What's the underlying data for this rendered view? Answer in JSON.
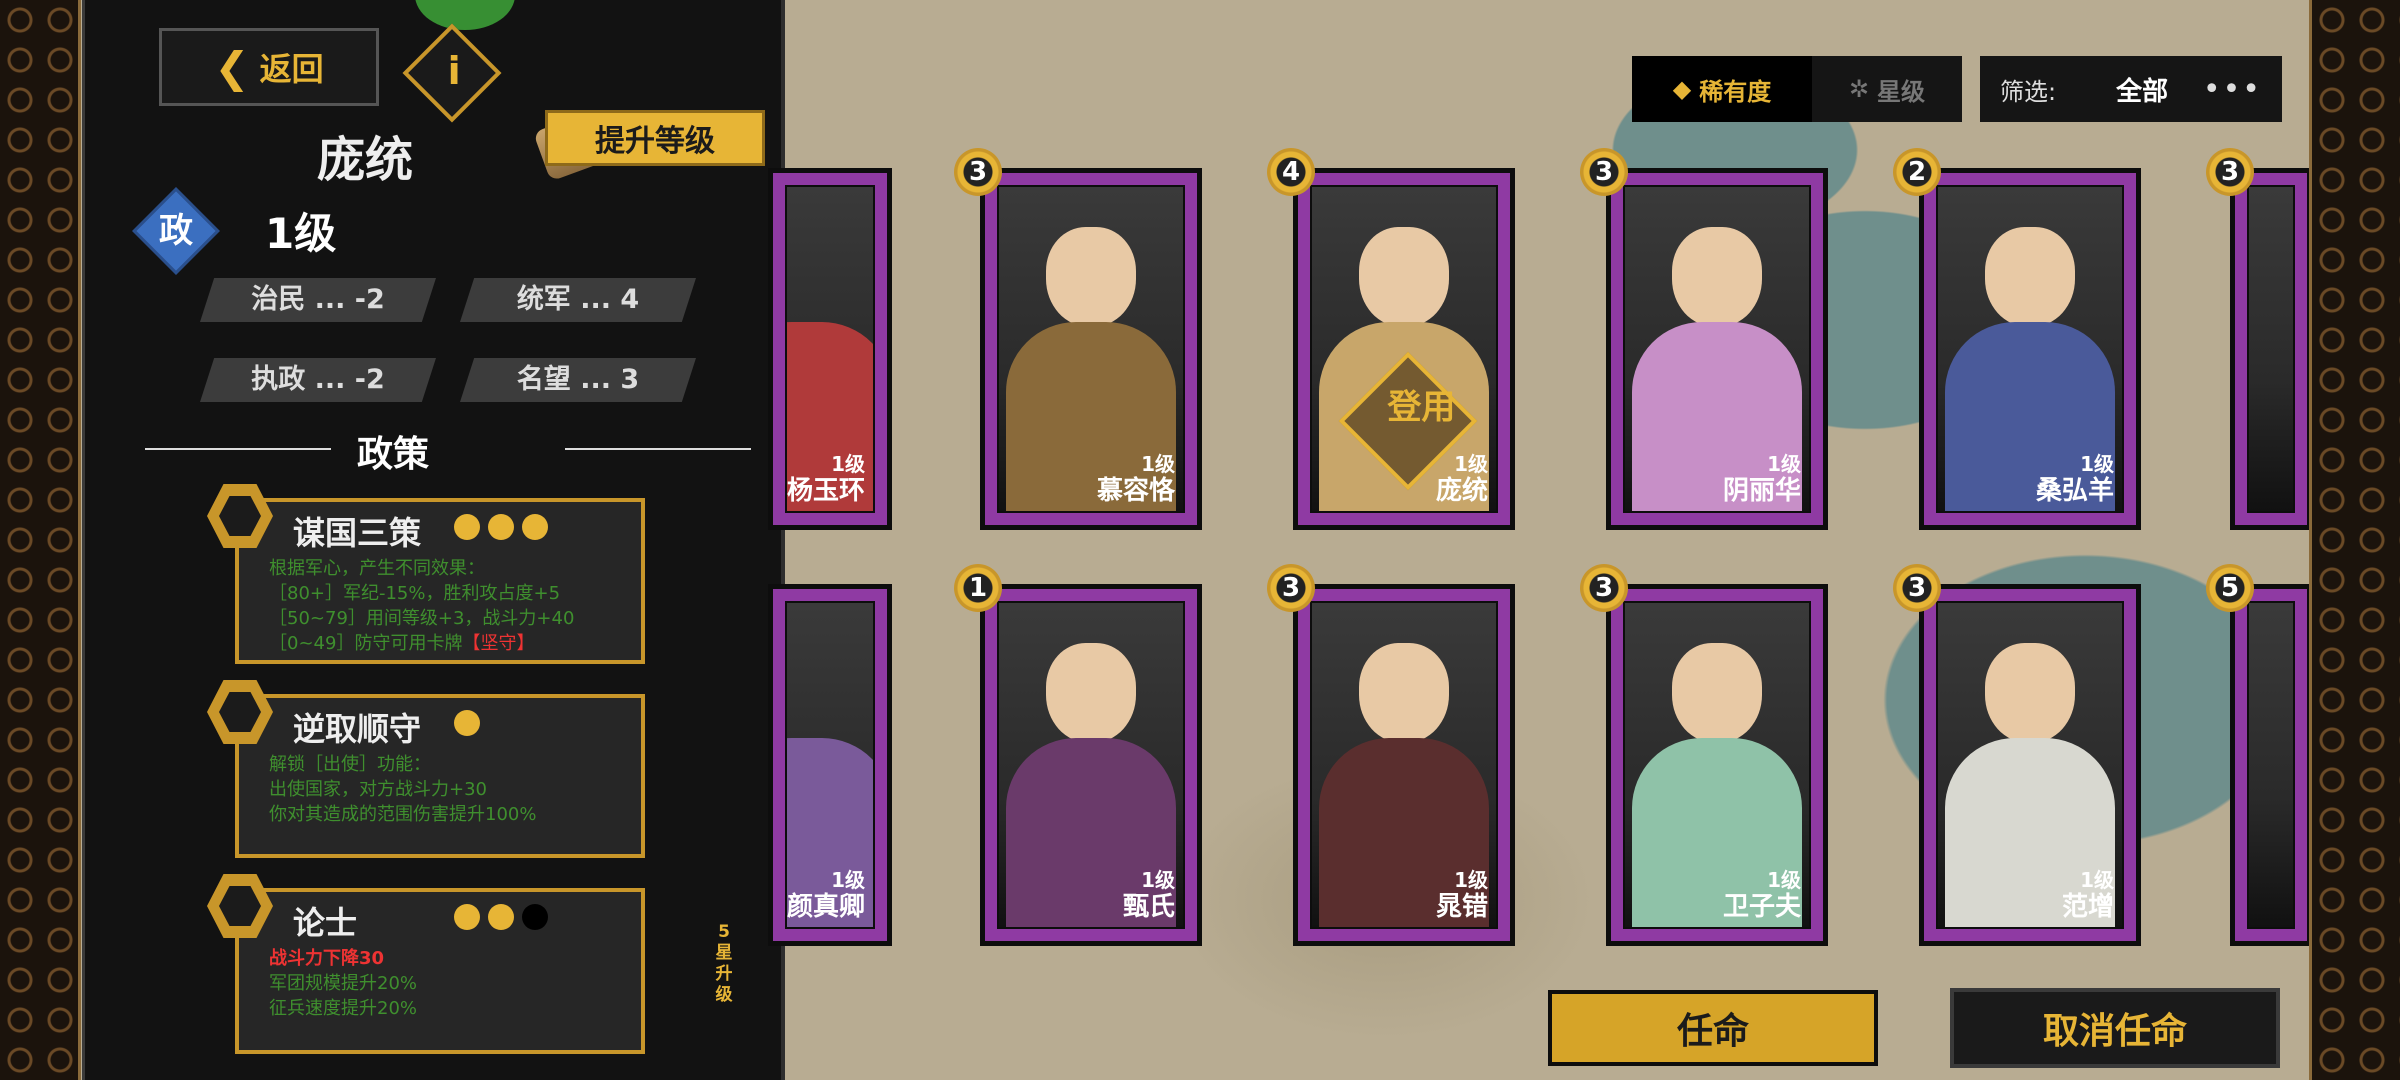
{
  "panel": {
    "back_label": "返回",
    "info_label": "i",
    "upgrade_label": "提升等级",
    "character_name": "庞统",
    "role_label": "政",
    "role_level": "1级",
    "stats": [
      {
        "label": "治民 ... -2"
      },
      {
        "label": "统军 ... 4"
      },
      {
        "label": "执政 ... -2"
      },
      {
        "label": "名望 ... 3"
      }
    ],
    "section_title": "政策",
    "policies": [
      {
        "title": "谋国三策",
        "dots_on": 3,
        "dots_total": 3,
        "lines": [
          "根据军心，产生不同效果：",
          "［80+］军纪-15%，胜利攻占度+5",
          "［50~79］用间等级+3，战斗力+40",
          "［0~49］防守可用卡牌"
        ],
        "tag": "【坚守】"
      },
      {
        "title": "逆取顺守",
        "dots_on": 1,
        "dots_total": 1,
        "lines": [
          "解锁［出使］功能：",
          "出使国家，对方战斗力+30",
          "你对其造成的范围伤害提升100%"
        ]
      },
      {
        "title": "论士",
        "dots_on": 2,
        "dots_total": 3,
        "red_line": "战斗力下降30",
        "lines": [
          "军团规模提升20%",
          "征兵速度提升20%"
        ],
        "star_note": "5星升级"
      }
    ]
  },
  "sort": {
    "active_label": "稀有度",
    "inactive_label": "星级"
  },
  "filter": {
    "label": "筛选:",
    "value": "全部",
    "more": "•••"
  },
  "cards_row1": [
    {
      "name": "杨玉环",
      "level": "1级",
      "rarity": ""
    },
    {
      "name": "慕容恪",
      "level": "1级",
      "rarity": "3"
    },
    {
      "name": "庞统",
      "level": "1级",
      "rarity": "4",
      "stamp": "登用"
    },
    {
      "name": "阴丽华",
      "level": "1级",
      "rarity": "3"
    },
    {
      "name": "桑弘羊",
      "level": "1级",
      "rarity": "2"
    },
    {
      "name": "",
      "level": "",
      "rarity": "3"
    }
  ],
  "cards_row2": [
    {
      "name": "颜真卿",
      "level": "1级",
      "rarity": ""
    },
    {
      "name": "甄氏",
      "level": "1级",
      "rarity": "1"
    },
    {
      "name": "晁错",
      "level": "1级",
      "rarity": "3"
    },
    {
      "name": "卫子夫",
      "level": "1级",
      "rarity": "3"
    },
    {
      "name": "范增",
      "level": "1级",
      "rarity": "3"
    },
    {
      "name": "",
      "level": "",
      "rarity": "5"
    }
  ],
  "buttons": {
    "appoint_label": "任命",
    "cancel_label": "取消任命"
  },
  "colors": {
    "accent_gold": "#e7b536",
    "card_border_purple": "#8f3aa3",
    "policy_green": "#3f8f2e",
    "warning_red": "#e33333"
  }
}
